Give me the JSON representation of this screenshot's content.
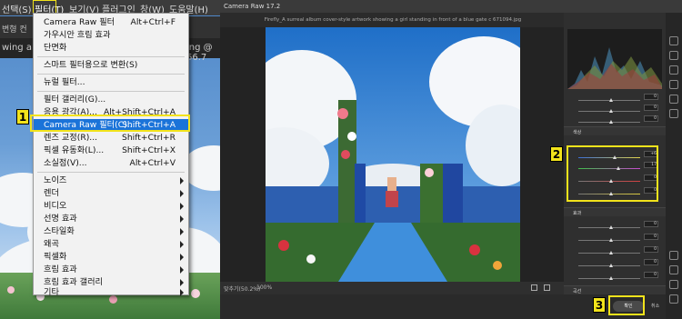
{
  "photoshop": {
    "menubar": [
      "선택(S)",
      "필터(T)",
      "보기(V)",
      "플러그인",
      "창(W)",
      "도움말(H)"
    ],
    "option_bar_text": "변형 컨",
    "doc_tab_left": "wing a g",
    "doc_tab_right": "ing @ 66.7"
  },
  "filter_menu": {
    "items": [
      {
        "label": "Camera Raw 필터",
        "shortcut": "Alt+Ctrl+F"
      },
      {
        "label": "가우시안 흐림 효과",
        "shortcut": ""
      },
      {
        "label": "단면화",
        "shortcut": ""
      },
      {
        "label": "스마트 필터용으로 변환(S)",
        "shortcut": ""
      },
      {
        "label": "뉴럴 필터...",
        "shortcut": ""
      },
      {
        "label": "필터 갤러리(G)...",
        "shortcut": ""
      },
      {
        "label": "응용 광각(A)...",
        "shortcut": "Alt+Shift+Ctrl+A"
      },
      {
        "label": "Camera Raw 필터(C)...",
        "shortcut": "Shift+Ctrl+A"
      },
      {
        "label": "렌즈 교정(R)...",
        "shortcut": "Shift+Ctrl+R"
      },
      {
        "label": "픽셀 유동화(L)...",
        "shortcut": "Shift+Ctrl+X"
      },
      {
        "label": "소실점(V)...",
        "shortcut": "Alt+Ctrl+V"
      },
      {
        "label": "노이즈",
        "shortcut": ""
      },
      {
        "label": "렌더",
        "shortcut": ""
      },
      {
        "label": "비디오",
        "shortcut": ""
      },
      {
        "label": "선명 효과",
        "shortcut": ""
      },
      {
        "label": "스타일화",
        "shortcut": ""
      },
      {
        "label": "왜곡",
        "shortcut": ""
      },
      {
        "label": "픽셀화",
        "shortcut": ""
      },
      {
        "label": "흐림 효과",
        "shortcut": ""
      },
      {
        "label": "흐림 효과 갤러리",
        "shortcut": ""
      },
      {
        "label": "기타",
        "shortcut": ""
      }
    ],
    "highlighted_index": 7
  },
  "callouts": [
    "1",
    "2",
    "3"
  ],
  "camera_raw": {
    "title": "Camera Raw 17.2",
    "file_name": "Firefly_A surreal album cover-style artwork showing a girl standing in front of a blue gate c 671094.jpg",
    "zoom_dropdown": "맞추기(50.2%)",
    "zoom_value": "100%",
    "ok_button": "확인",
    "cancel_button": "취소",
    "panel": {
      "section_color": "색상",
      "section_effects": "효과",
      "section_curve": "곡선",
      "temp_value": "+6",
      "tint_value": "17",
      "vibrance_value": "0",
      "saturation_value": "0",
      "effect_values": [
        "0",
        "0",
        "0",
        "0",
        "0",
        "0"
      ],
      "top_values": [
        "0",
        "0",
        "0",
        "0",
        "0",
        "0"
      ]
    },
    "colors": {
      "accent": "#f2e31b",
      "highlight": "#1a73d9"
    }
  }
}
